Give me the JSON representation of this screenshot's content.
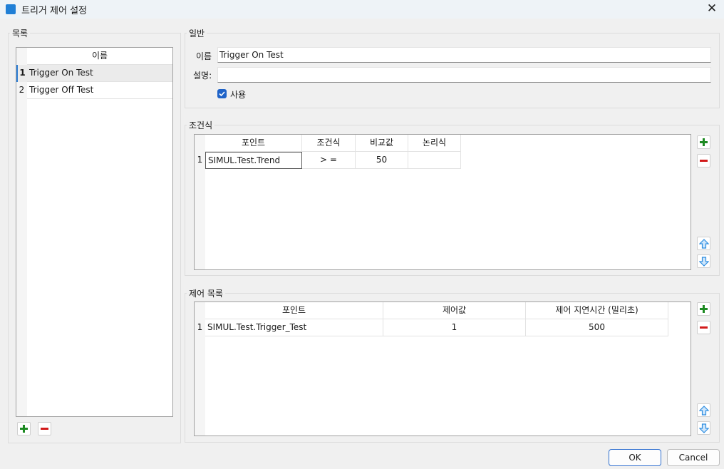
{
  "window": {
    "title": "트리거 제어 설정",
    "close_glyph": "✕"
  },
  "list_group": {
    "label": "목록",
    "column_header": "이름",
    "rows": [
      {
        "num": "1",
        "name": "Trigger On Test"
      },
      {
        "num": "2",
        "name": "Trigger Off Test"
      }
    ]
  },
  "general": {
    "label": "일반",
    "name_label": "이름",
    "name_value": "Trigger On Test",
    "desc_label": "설명:",
    "desc_value": "",
    "enabled_label": "사용",
    "enabled": true
  },
  "condition": {
    "label": "조건식",
    "headers": [
      "포인트",
      "조건식",
      "비교값",
      "논리식"
    ],
    "rows": [
      {
        "num": "1",
        "point": "SIMUL.Test.Trend",
        "op": "> =",
        "value": "50",
        "logic": ""
      }
    ]
  },
  "control": {
    "label": "제어 목록",
    "headers": [
      "포인트",
      "제어값",
      "제어 지연시간 (밀리초)"
    ],
    "rows": [
      {
        "num": "1",
        "point": "SIMUL.Test.Trigger_Test",
        "value": "1",
        "delay": "500"
      }
    ]
  },
  "buttons": {
    "ok": "OK",
    "cancel": "Cancel"
  },
  "icons": {
    "add": "plus-icon",
    "remove": "minus-icon",
    "up": "arrow-up-icon",
    "down": "arrow-down-icon",
    "add_color": "#1d8a22",
    "remove_color": "#d21a1a",
    "arrow_color": "#2d8de0",
    "accent": "#1f63c8"
  }
}
